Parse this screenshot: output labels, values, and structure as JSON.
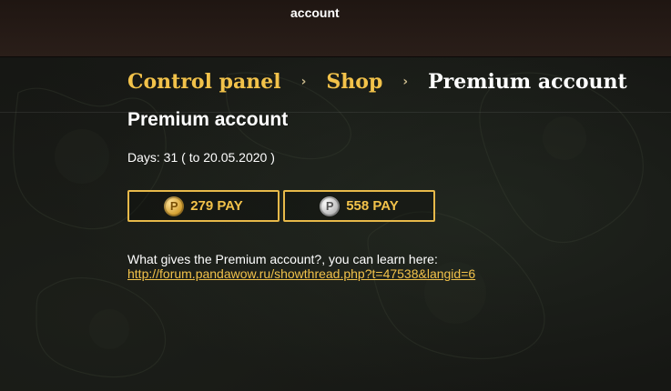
{
  "top_bar": {
    "text": "account"
  },
  "breadcrumb": {
    "items": [
      {
        "label": "Control panel"
      },
      {
        "label": "Shop"
      }
    ],
    "separator": "›",
    "current": "Premium account"
  },
  "page_title": "Premium account",
  "days": {
    "text": "Days: 31 ( to 20.05.2020 )"
  },
  "buttons": [
    {
      "coin_letter": "P",
      "coin_type": "gold-coin-icon",
      "label": "279 PAY"
    },
    {
      "coin_letter": "P",
      "coin_type": "silver-coin-icon",
      "label": "558 PAY"
    }
  ],
  "info": {
    "text": "What gives the Premium account?, you can learn here:",
    "link": "http://forum.pandawow.ru/showthread.php?t=47538&langid=6"
  },
  "colors": {
    "accent": "#f2c24a",
    "button_border": "#e7b94a",
    "background": "#161714",
    "top_bar": "#241a16"
  }
}
